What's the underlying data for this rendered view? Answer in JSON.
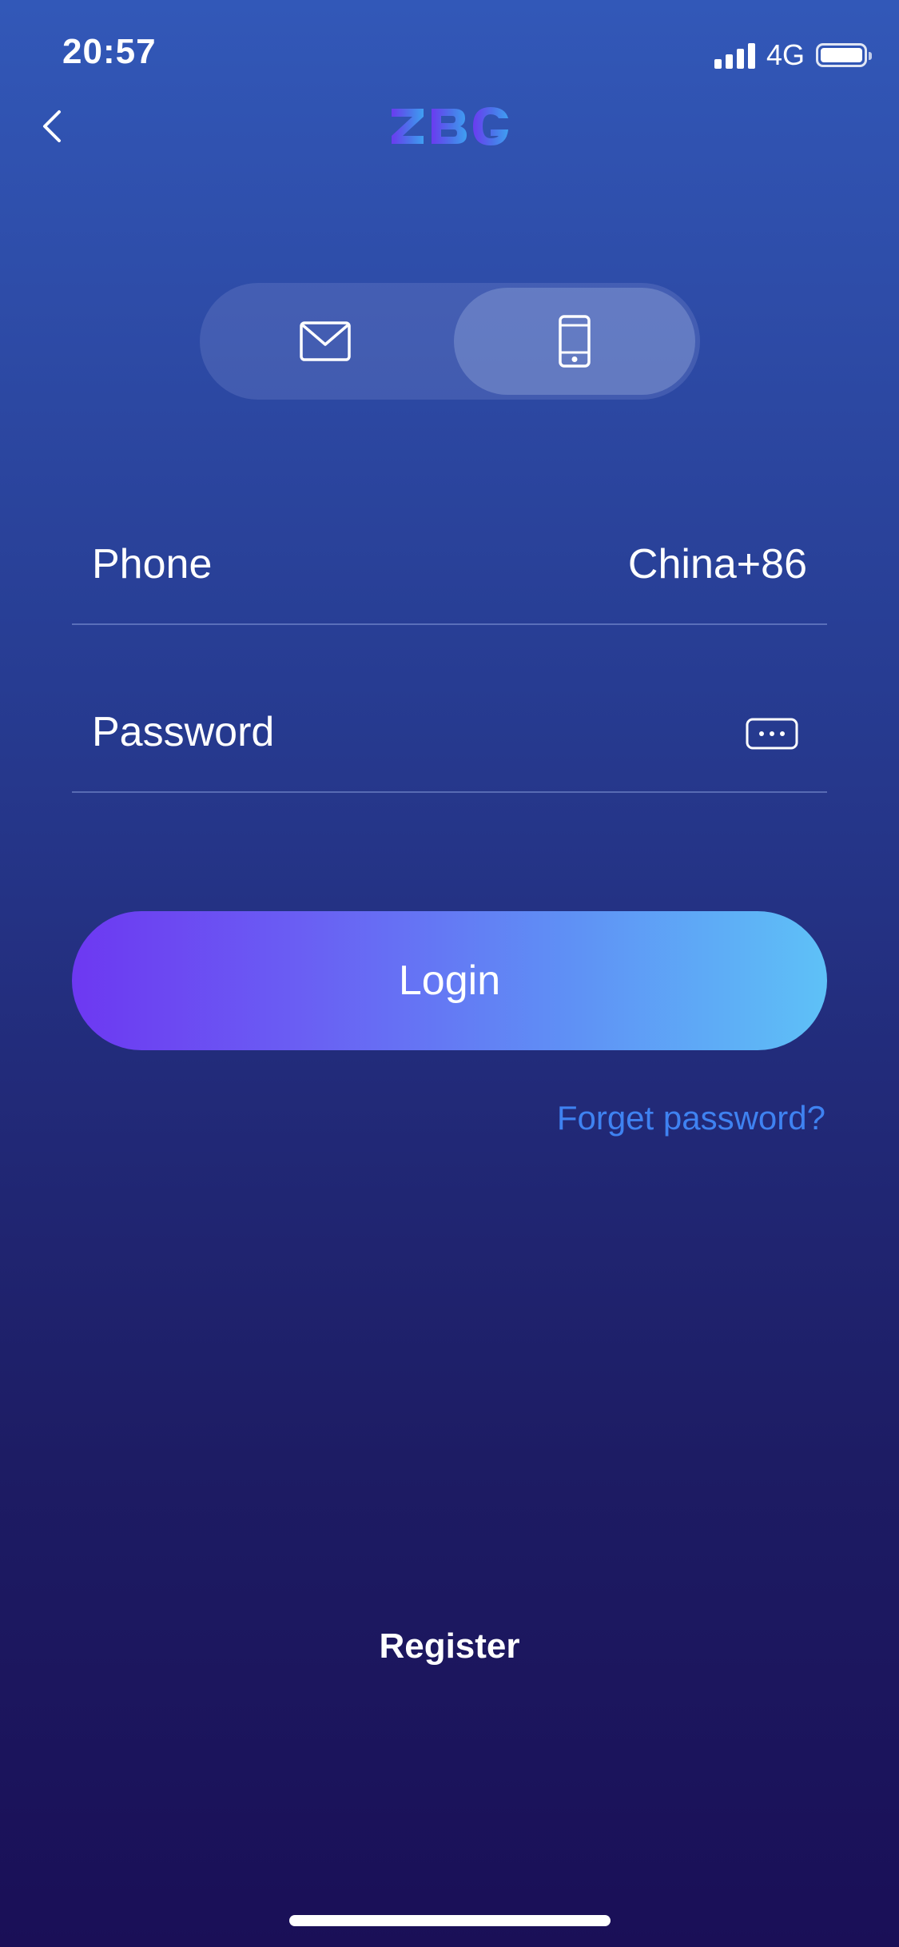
{
  "status_bar": {
    "time": "20:57",
    "network": "4G"
  },
  "nav": {
    "logo_text": "ZBG",
    "logo_colors": [
      "#6a3bf0",
      "#4c72ea",
      "#3f9ff2"
    ]
  },
  "login_mode_tabs": [
    {
      "icon": "mail-icon",
      "selected": false
    },
    {
      "icon": "mobile-phone-icon",
      "selected": true
    }
  ],
  "form": {
    "phone_label": "Phone",
    "country_code": "China+86",
    "password_label": "Password"
  },
  "actions": {
    "login_label": "Login",
    "forget_label": "Forget password?",
    "register_label": "Register"
  },
  "colors": {
    "login_gradient_start": "#6d38f2",
    "login_gradient_end": "#5ec1f7",
    "link": "#3f82f1"
  }
}
